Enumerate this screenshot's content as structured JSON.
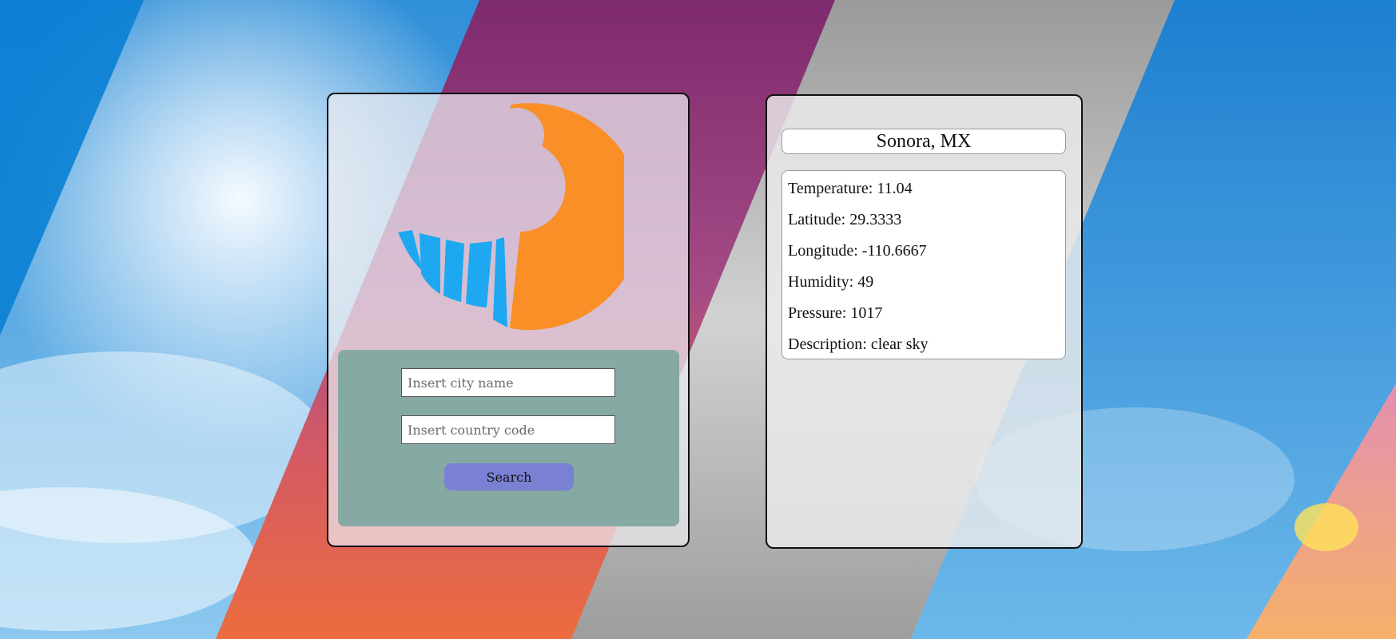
{
  "search_form": {
    "city_placeholder": "Insert city name",
    "country_placeholder": "Insert country code",
    "search_label": "Search"
  },
  "weather": {
    "location": "Sonora, MX",
    "lines": [
      "Temperature: 11.04",
      "Latitude: 29.3333",
      "Longitude: -110.6667",
      "Humidity: 49",
      "Pressure: 1017",
      "Description: clear sky"
    ]
  },
  "icons": {
    "logo": "weather-moon-rain-logo"
  },
  "colors": {
    "logo_orange": "#f98f26",
    "logo_blue": "#1ea8f2",
    "form_background": "#86a9a4",
    "search_button": "#7a80d2"
  }
}
